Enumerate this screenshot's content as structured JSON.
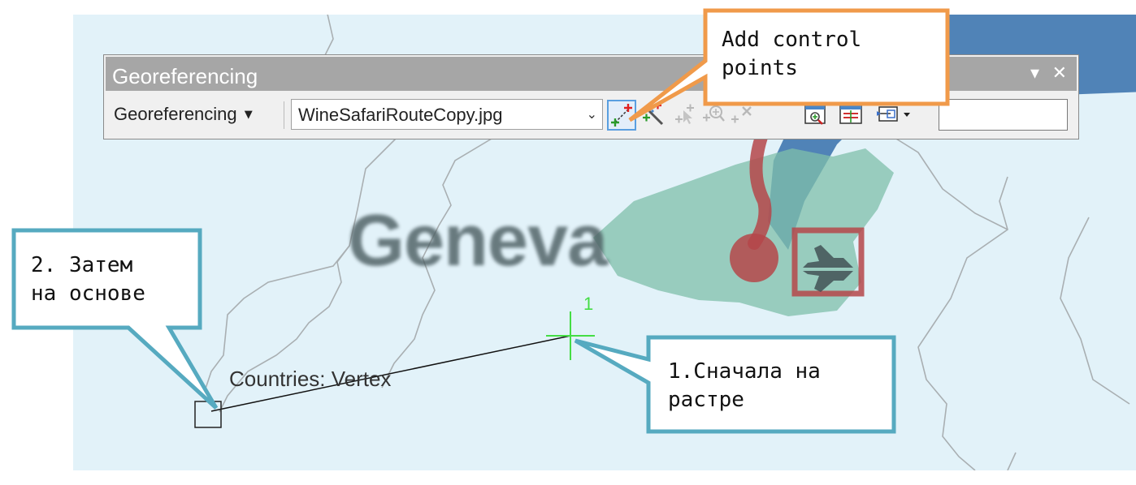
{
  "map": {
    "raster_label": "Geneva",
    "vertex_label": "Countries: Vertex",
    "control_point_number": "1"
  },
  "toolbar": {
    "title": "Georeferencing",
    "menu_label": "Georeferencing",
    "layer_select": {
      "value": "WineSafariRouteCopy.jpg"
    },
    "text_input": {
      "value": ""
    },
    "buttons": [
      {
        "name": "add-control-points",
        "icon": "add-control-points-icon",
        "enabled": true,
        "active": true
      },
      {
        "name": "auto-registration",
        "icon": "auto-registration-icon",
        "enabled": true
      },
      {
        "name": "select-link",
        "icon": "select-link-icon",
        "enabled": false
      },
      {
        "name": "zoom-to-link",
        "icon": "zoom-to-link-icon",
        "enabled": false
      },
      {
        "name": "delete-link",
        "icon": "delete-link-icon",
        "enabled": false
      },
      {
        "name": "viewer",
        "icon": "viewer-icon",
        "enabled": true
      },
      {
        "name": "link-table",
        "icon": "link-table-icon",
        "enabled": true
      },
      {
        "name": "inset-window",
        "icon": "inset-window-icon",
        "enabled": true
      }
    ]
  },
  "callouts": {
    "top": {
      "line1": "Add control",
      "line2": "points",
      "border_color": "#f09a4a"
    },
    "left": {
      "line1": "2. Затем",
      "line2": "на основе",
      "border_color": "#56aac0"
    },
    "right": {
      "line1": "1.Сначала на",
      "line2": "растре",
      "border_color": "#56aac0"
    }
  },
  "colors": {
    "map_background": "#e2f2f9",
    "boundary_lines": "#a9afb2",
    "lake": "#2c67a6",
    "land": "#7fbfaa",
    "route_red": "#b5474a",
    "control_point_green": "#44dd44",
    "toolbar_title_bar": "#a6a6a6"
  }
}
